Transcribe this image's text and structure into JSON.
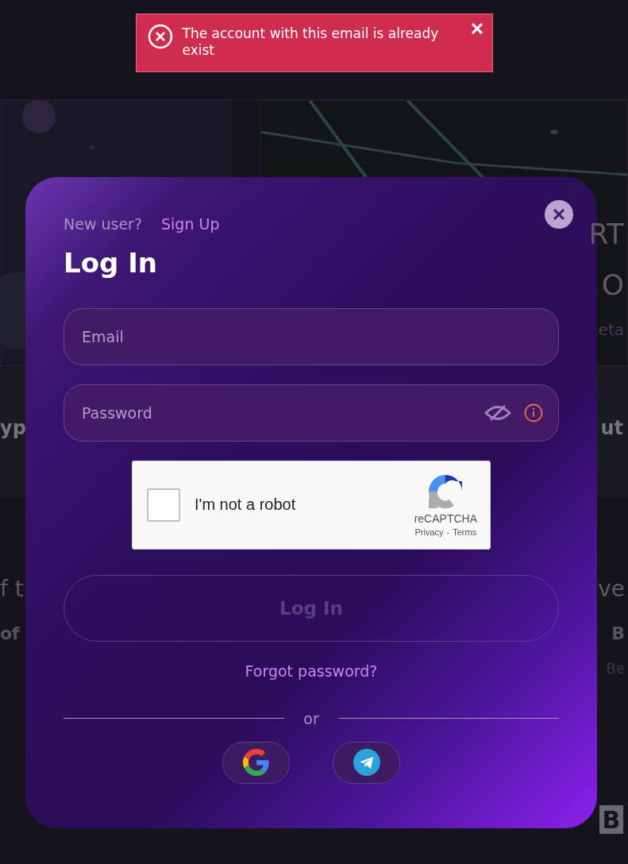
{
  "toast": {
    "kind": "error",
    "message": "The account with this email is already exist"
  },
  "background": {
    "card_right_texts": [
      "RT",
      "O",
      "eta"
    ],
    "band": {
      "left": "yp",
      "right": "ut"
    },
    "section": [
      {
        "left": "f t",
        "right": "ve",
        "kind": "heading"
      },
      {
        "left": "of",
        "right": "B",
        "kind": "title"
      },
      {
        "right": "Be",
        "kind": "sub"
      }
    ],
    "logo": "B"
  },
  "modal": {
    "prompt": "New user?",
    "signup": "Sign Up",
    "title": "Log In",
    "email": {
      "placeholder": "Email"
    },
    "password": {
      "placeholder": "Password",
      "masked": true,
      "warning": true
    },
    "captcha": {
      "label": "I'm not a robot",
      "checked": false,
      "brand": "reCAPTCHA",
      "privacy": "Privacy",
      "separator": "-",
      "terms": "Terms"
    },
    "submit": {
      "label": "Log In",
      "disabled": true
    },
    "forgot": "Forgot password?",
    "divider": "or",
    "social": [
      {
        "kind": "google"
      },
      {
        "kind": "telegram"
      }
    ]
  }
}
